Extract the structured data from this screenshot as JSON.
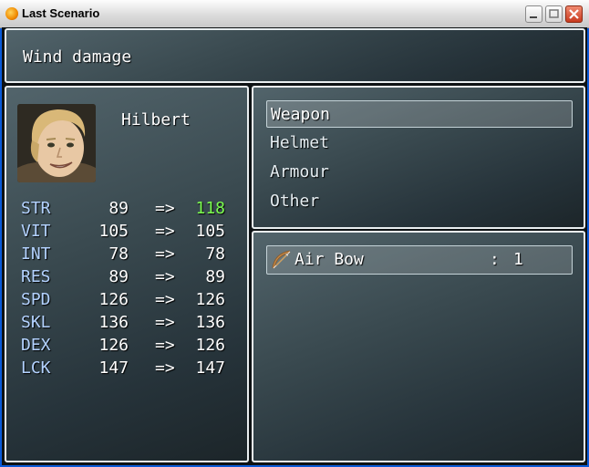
{
  "window": {
    "title": "Last Scenario"
  },
  "help": {
    "text": "Wind damage"
  },
  "actor": {
    "name": "Hilbert",
    "stats": [
      {
        "label": "STR",
        "current": "89",
        "arrow": "=>",
        "new": "118",
        "improved": true
      },
      {
        "label": "VIT",
        "current": "105",
        "arrow": "=>",
        "new": "105",
        "improved": false
      },
      {
        "label": "INT",
        "current": "78",
        "arrow": "=>",
        "new": "78",
        "improved": false
      },
      {
        "label": "RES",
        "current": "89",
        "arrow": "=>",
        "new": "89",
        "improved": false
      },
      {
        "label": "SPD",
        "current": "126",
        "arrow": "=>",
        "new": "126",
        "improved": false
      },
      {
        "label": "SKL",
        "current": "136",
        "arrow": "=>",
        "new": "136",
        "improved": false
      },
      {
        "label": "DEX",
        "current": "126",
        "arrow": "=>",
        "new": "126",
        "improved": false
      },
      {
        "label": "LCK",
        "current": "147",
        "arrow": "=>",
        "new": "147",
        "improved": false
      }
    ]
  },
  "equip_slots": [
    {
      "label": "Weapon",
      "selected": true
    },
    {
      "label": "Helmet",
      "selected": false
    },
    {
      "label": "Armour",
      "selected": false
    },
    {
      "label": "Other",
      "selected": false
    }
  ],
  "items": [
    {
      "name": "Air Bow",
      "separator": ":",
      "count": "1",
      "icon": "bow-icon"
    }
  ],
  "colors": {
    "stat_label": "#b3d2ff",
    "stat_up": "#7cff50",
    "panel_border": "#e9eef0"
  }
}
